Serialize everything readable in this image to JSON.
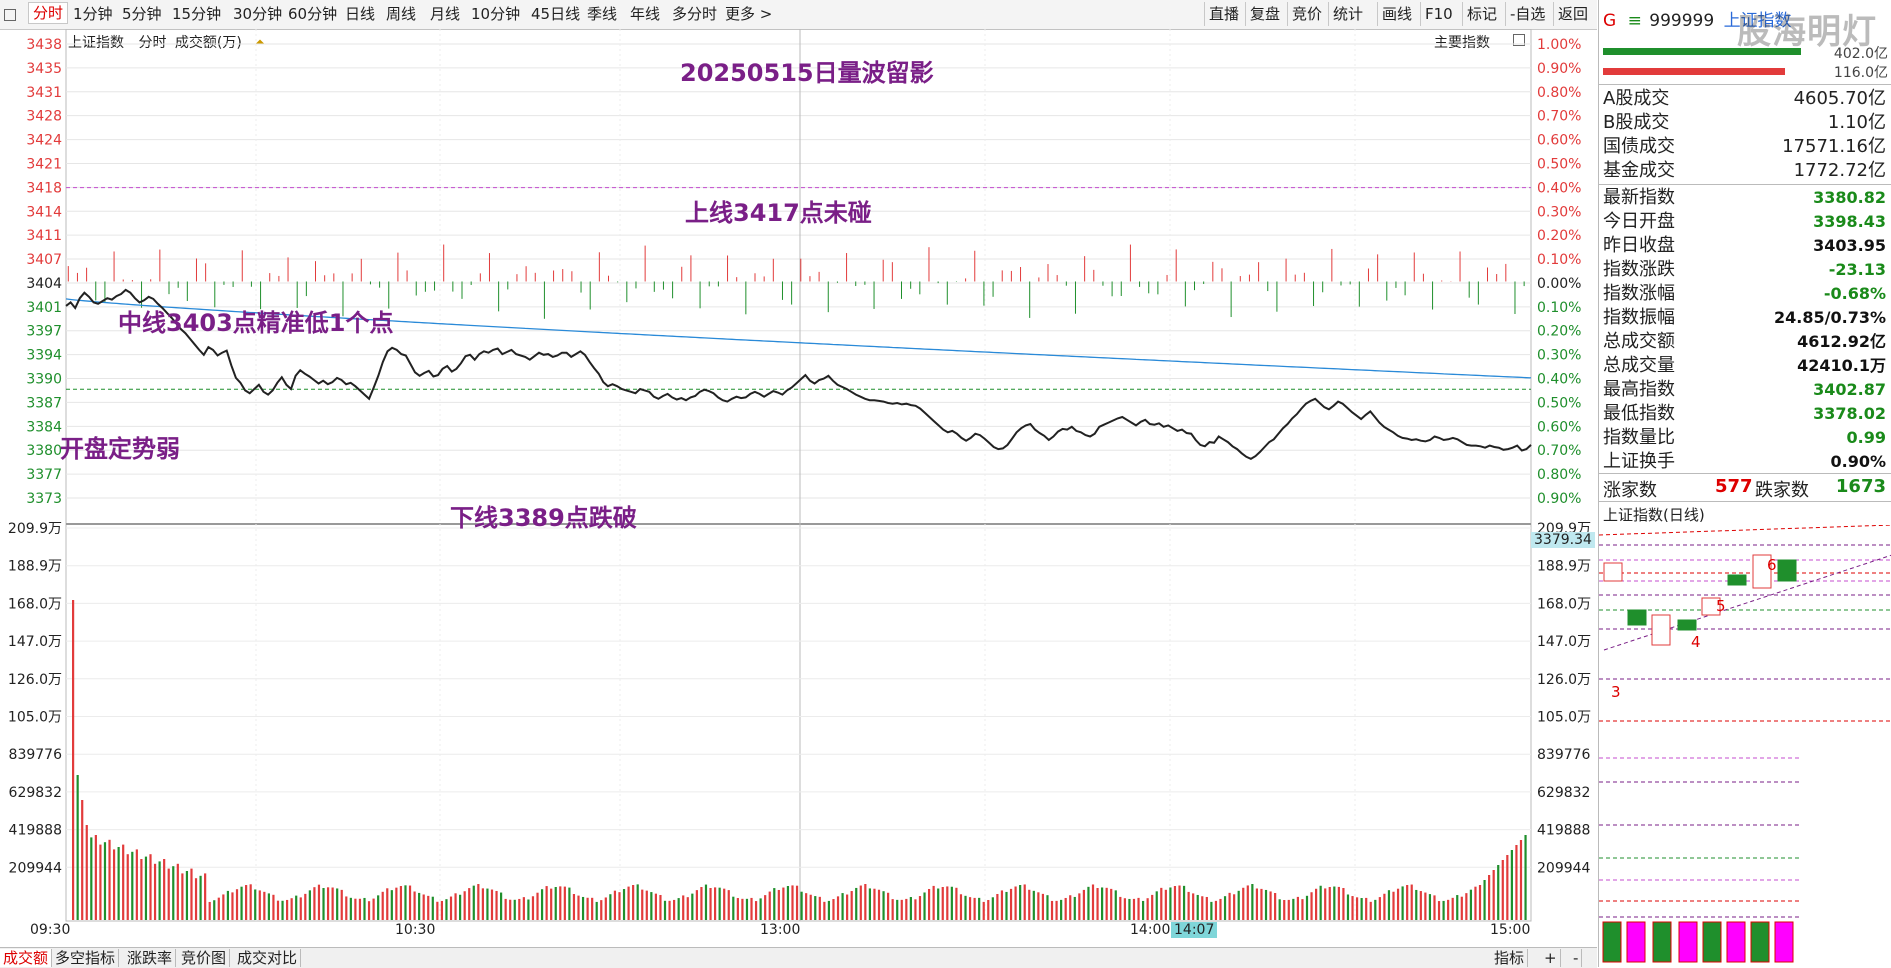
{
  "topbar": {
    "tabs": [
      "分时",
      "1分钟",
      "5分钟",
      "15分钟",
      "30分钟",
      "60分钟",
      "日线",
      "周线",
      "月线",
      "10分钟",
      "45日线",
      "季线",
      "年线",
      "多分时",
      "更多 >"
    ],
    "active_tab": "分时",
    "right_buttons": [
      "直播",
      "复盘",
      "竞价",
      "统计",
      "画线",
      "F10",
      "标记",
      "-自选",
      "返回"
    ]
  },
  "chart_header": {
    "index_name": "上证指数",
    "mode": "分时",
    "unit": "成交额(万)",
    "main_index_label": "主要指数"
  },
  "annotations": {
    "title": "20250515日量波留影",
    "upper": "上线3417点未碰",
    "middle": "中线3403点精准低1个点",
    "open": "开盘定势弱",
    "lower": "下线3389点跌破"
  },
  "price_axis": [
    "3438",
    "3435",
    "3431",
    "3428",
    "3424",
    "3421",
    "3418",
    "3414",
    "3411",
    "3407",
    "3404",
    "3401",
    "3397",
    "3394",
    "3390",
    "3387",
    "3384",
    "3380",
    "3377",
    "3373"
  ],
  "pct_axis": [
    "1.00%",
    "0.90%",
    "0.80%",
    "0.70%",
    "0.60%",
    "0.50%",
    "0.40%",
    "0.30%",
    "0.20%",
    "0.10%",
    "0.00%",
    "0.10%",
    "0.20%",
    "0.30%",
    "0.40%",
    "0.50%",
    "0.60%",
    "0.70%",
    "0.80%",
    "0.90%"
  ],
  "volume_axis_left": [
    "209.9万",
    "188.9万",
    "168.0万",
    "147.0万",
    "126.0万",
    "105.0万",
    "839776",
    "629832",
    "419888",
    "209944"
  ],
  "volume_axis_right": [
    "209.9万",
    "188.9万",
    "168.0万",
    "147.0万",
    "126.0万",
    "105.0万",
    "839776",
    "629832",
    "419888",
    "209944"
  ],
  "time_axis": [
    "09:30",
    "10:30",
    "13:00",
    "14:00",
    "15:00"
  ],
  "cursor_time": "14:07",
  "last_price_tag": "3379.34",
  "bottom_tabs": [
    "成交额",
    "多空指标",
    "涨跌率",
    "竞价图",
    "成交对比"
  ],
  "bottom_right": [
    "指标",
    "+",
    "-"
  ],
  "right_panel": {
    "code_prefix": "G",
    "code": "999999",
    "name": "上证指数",
    "watermark": "股海明灯",
    "bar_values": [
      "402.0亿",
      "116.0亿"
    ],
    "turnover": [
      {
        "k": "A股成交",
        "v": "4605.70亿"
      },
      {
        "k": "B股成交",
        "v": "1.10亿"
      },
      {
        "k": "国债成交",
        "v": "17571.16亿"
      },
      {
        "k": "基金成交",
        "v": "1772.72亿"
      }
    ],
    "stats": [
      {
        "k": "最新指数",
        "v": "3380.82",
        "c": "#1a8a1a"
      },
      {
        "k": "今日开盘",
        "v": "3398.43",
        "c": "#1a8a1a"
      },
      {
        "k": "昨日收盘",
        "v": "3403.95",
        "c": "#111"
      },
      {
        "k": "指数涨跌",
        "v": "-23.13",
        "c": "#1a8a1a"
      },
      {
        "k": "指数涨幅",
        "v": "-0.68%",
        "c": "#1a8a1a"
      },
      {
        "k": "指数振幅",
        "v": "24.85/0.73%",
        "c": "#111"
      },
      {
        "k": "总成交额",
        "v": "4612.92亿",
        "c": "#111"
      },
      {
        "k": "总成交量",
        "v": "42410.1万",
        "c": "#111"
      },
      {
        "k": "最高指数",
        "v": "3402.87",
        "c": "#1a8a1a"
      },
      {
        "k": "最低指数",
        "v": "3378.02",
        "c": "#1a8a1a"
      },
      {
        "k": "指数量比",
        "v": "0.99",
        "c": "#1a8a1a"
      },
      {
        "k": "上证换手",
        "v": "0.90%",
        "c": "#111"
      }
    ],
    "breadth": {
      "up_label": "涨家数",
      "up": "577",
      "down_label": "跌家数",
      "down": "1673"
    },
    "daily_title": "上证指数(日线)",
    "wave_labels": [
      "3",
      "4",
      "5",
      "6"
    ]
  },
  "colors": {
    "up": "#e23b3b",
    "down": "#1f8f2c",
    "avg": "#2a8ad8",
    "price": "#222222",
    "annot": "#7a1f87"
  },
  "chart_data": {
    "type": "line",
    "title": "上证指数 分时",
    "prev_close": 3403.95,
    "ylim": [
      3371,
      3440
    ],
    "price_series": [
      3400.5,
      3401.0,
      3400.2,
      3401.6,
      3402.4,
      3401.8,
      3401.0,
      3400.8,
      3401.2,
      3401.6,
      3401.4,
      3401.9,
      3402.2,
      3402.8,
      3402.4,
      3401.6,
      3401.0,
      3401.3,
      3401.8,
      3401.5,
      3400.8,
      3400.2,
      3399.5,
      3398.8,
      3398.0,
      3397.2,
      3396.6,
      3395.8,
      3395.0,
      3394.2,
      3393.5,
      3394.6,
      3394.2,
      3393.4,
      3393.8,
      3394.1,
      3392.0,
      3390.2,
      3389.5,
      3388.4,
      3388.0,
      3388.6,
      3389.2,
      3388.2,
      3387.8,
      3388.4,
      3389.5,
      3390.3,
      3389.2,
      3388.6,
      3390.5,
      3391.3,
      3390.8,
      3390.4,
      3389.9,
      3389.4,
      3389.8,
      3389.3,
      3389.6,
      3390.2,
      3389.9,
      3389.3,
      3389.5,
      3389.0,
      3388.4,
      3387.8,
      3387.2,
      3388.8,
      3390.5,
      3392.5,
      3394.0,
      3394.5,
      3394.2,
      3393.6,
      3393.4,
      3392.2,
      3391.0,
      3390.5,
      3390.9,
      3391.2,
      3390.4,
      3390.6,
      3391.5,
      3391.9,
      3391.1,
      3391.5,
      3392.3,
      3393.3,
      3393.5,
      3392.8,
      3393.6,
      3394.0,
      3393.8,
      3394.2,
      3394.4,
      3393.6,
      3393.9,
      3394.2,
      3393.6,
      3393.4,
      3393.2,
      3392.8,
      3393.3,
      3393.8,
      3393.5,
      3393.6,
      3393.2,
      3393.4,
      3393.8,
      3393.8,
      3393.2,
      3393.6,
      3394.0,
      3393.5,
      3392.5,
      3391.6,
      3390.8,
      3389.6,
      3389.0,
      3389.3,
      3389.0,
      3388.6,
      3388.4,
      3388.2,
      3388.0,
      3388.6,
      3388.4,
      3388.2,
      3387.5,
      3387.2,
      3387.6,
      3387.9,
      3387.4,
      3387.1,
      3387.3,
      3387.0,
      3387.4,
      3387.6,
      3388.2,
      3388.5,
      3388.3,
      3388.0,
      3387.4,
      3387.0,
      3386.8,
      3387.2,
      3387.5,
      3387.3,
      3387.4,
      3387.9,
      3388.2,
      3387.9,
      3387.5,
      3387.9,
      3388.3,
      3388.1,
      3387.8,
      3388.4,
      3388.8,
      3389.4,
      3390.0,
      3390.6,
      3389.8,
      3389.4,
      3389.9,
      3390.1,
      3390.5,
      3389.8,
      3389.2,
      3388.9,
      3388.6,
      3388.2,
      3387.8,
      3387.5,
      3387.2,
      3387.0,
      3387.0,
      3386.9,
      3386.8,
      3386.6,
      3386.5,
      3386.6,
      3386.4,
      3386.5,
      3386.3,
      3386.2,
      3385.8,
      3385.2,
      3384.6,
      3384.0,
      3383.4,
      3382.8,
      3382.4,
      3382.6,
      3382.2,
      3381.6,
      3381.2,
      3381.6,
      3382.2,
      3382.0,
      3381.5,
      3380.9,
      3380.3,
      3380.0,
      3380.1,
      3380.6,
      3381.5,
      3382.4,
      3383.0,
      3383.4,
      3383.6,
      3382.8,
      3382.3,
      3381.9,
      3381.3,
      3381.8,
      3382.5,
      3382.9,
      3382.8,
      3383.2,
      3382.6,
      3382.4,
      3382.0,
      3381.8,
      3382.2,
      3383.2,
      3383.5,
      3383.8,
      3384.1,
      3384.4,
      3384.6,
      3384.2,
      3383.8,
      3383.4,
      3383.9,
      3384.2,
      3383.6,
      3383.5,
      3383.7,
      3383.2,
      3383.4,
      3383.0,
      3382.6,
      3382.8,
      3382.3,
      3382.2,
      3381.3,
      3380.6,
      3380.4,
      3381.0,
      3380.9,
      3381.8,
      3381.4,
      3381.0,
      3380.4,
      3380.0,
      3379.4,
      3378.9,
      3378.6,
      3379.0,
      3379.6,
      3380.3,
      3381.0,
      3381.4,
      3382.2,
      3383.0,
      3383.6,
      3384.4,
      3385.0,
      3385.8,
      3386.5,
      3386.9,
      3387.2,
      3386.6,
      3386.0,
      3385.7,
      3386.2,
      3386.8,
      3386.5,
      3385.9,
      3385.3,
      3384.8,
      3384.3,
      3384.9,
      3385.4,
      3384.6,
      3383.8,
      3383.2,
      3382.8,
      3382.4,
      3381.9,
      3381.6,
      3381.5,
      3381.3,
      3381.4,
      3381.2,
      3381.1,
      3381.3,
      3381.8,
      3381.6,
      3381.3,
      3381.4,
      3381.6,
      3381.4,
      3381.0,
      3380.6,
      3380.5,
      3380.5,
      3380.4,
      3380.2,
      3380.5,
      3380.3,
      3380.2,
      3379.9,
      3380.0,
      3380.2,
      3380.5,
      3379.8,
      3380.0,
      3380.6
    ],
    "avg_series_start": 3401.5,
    "avg_series_end": 3390.2,
    "upper_line": 3417,
    "lower_line": 3389
  }
}
